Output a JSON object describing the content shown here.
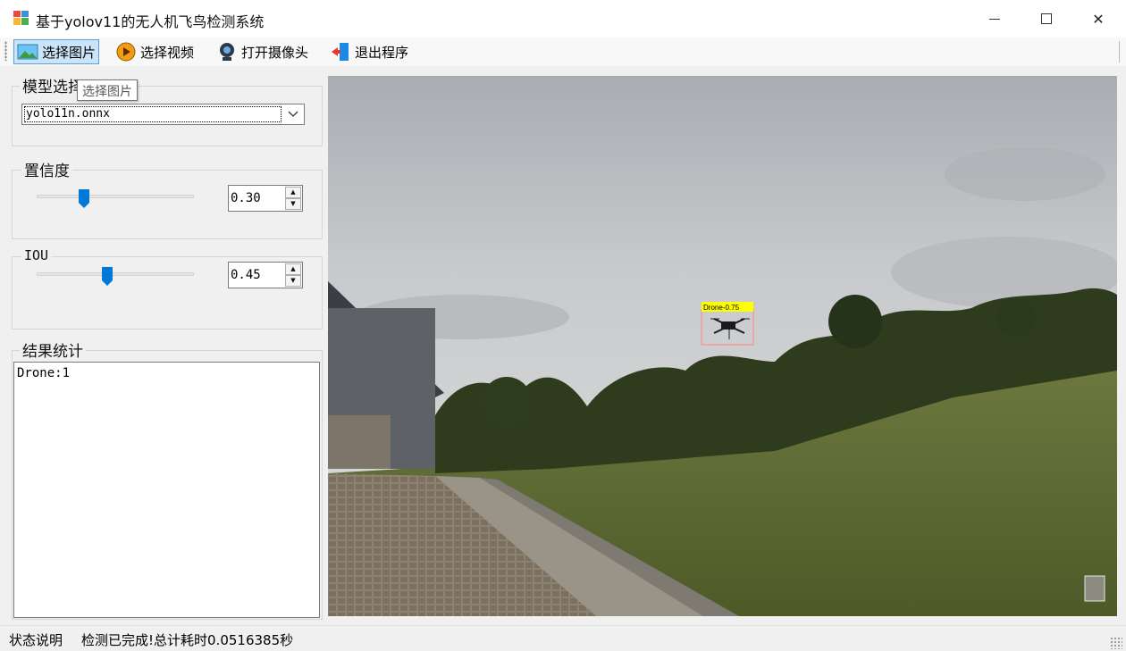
{
  "window": {
    "title": "基于yolov11的无人机飞鸟检测系统",
    "minimize_label": "−",
    "close_label": "✕"
  },
  "toolbar": {
    "items": [
      {
        "label": "选择图片",
        "icon": "picture-icon"
      },
      {
        "label": "选择视频",
        "icon": "play-video-icon"
      },
      {
        "label": "打开摄像头",
        "icon": "webcam-icon"
      },
      {
        "label": "退出程序",
        "icon": "exit-door-icon"
      }
    ],
    "tooltip": "选择图片"
  },
  "model_group": {
    "title": "模型选择",
    "selected": "yolo11n.onnx"
  },
  "confidence_group": {
    "title": "置信度",
    "value": "0.30",
    "level": 0.3
  },
  "iou_group": {
    "title": "IOU",
    "value": "0.45",
    "level": 0.45
  },
  "results_group": {
    "title": "结果统计",
    "text": "Drone:1"
  },
  "detection": {
    "label": "Drone-0.75",
    "box_color": "#f59a9a",
    "label_color": "#ffff00"
  },
  "status": {
    "label": "状态说明",
    "text": "检测已完成!总计耗时0.0516385秒"
  },
  "colors": {
    "accent": "#0078d7",
    "toolbar_active": "#cce4f7"
  }
}
